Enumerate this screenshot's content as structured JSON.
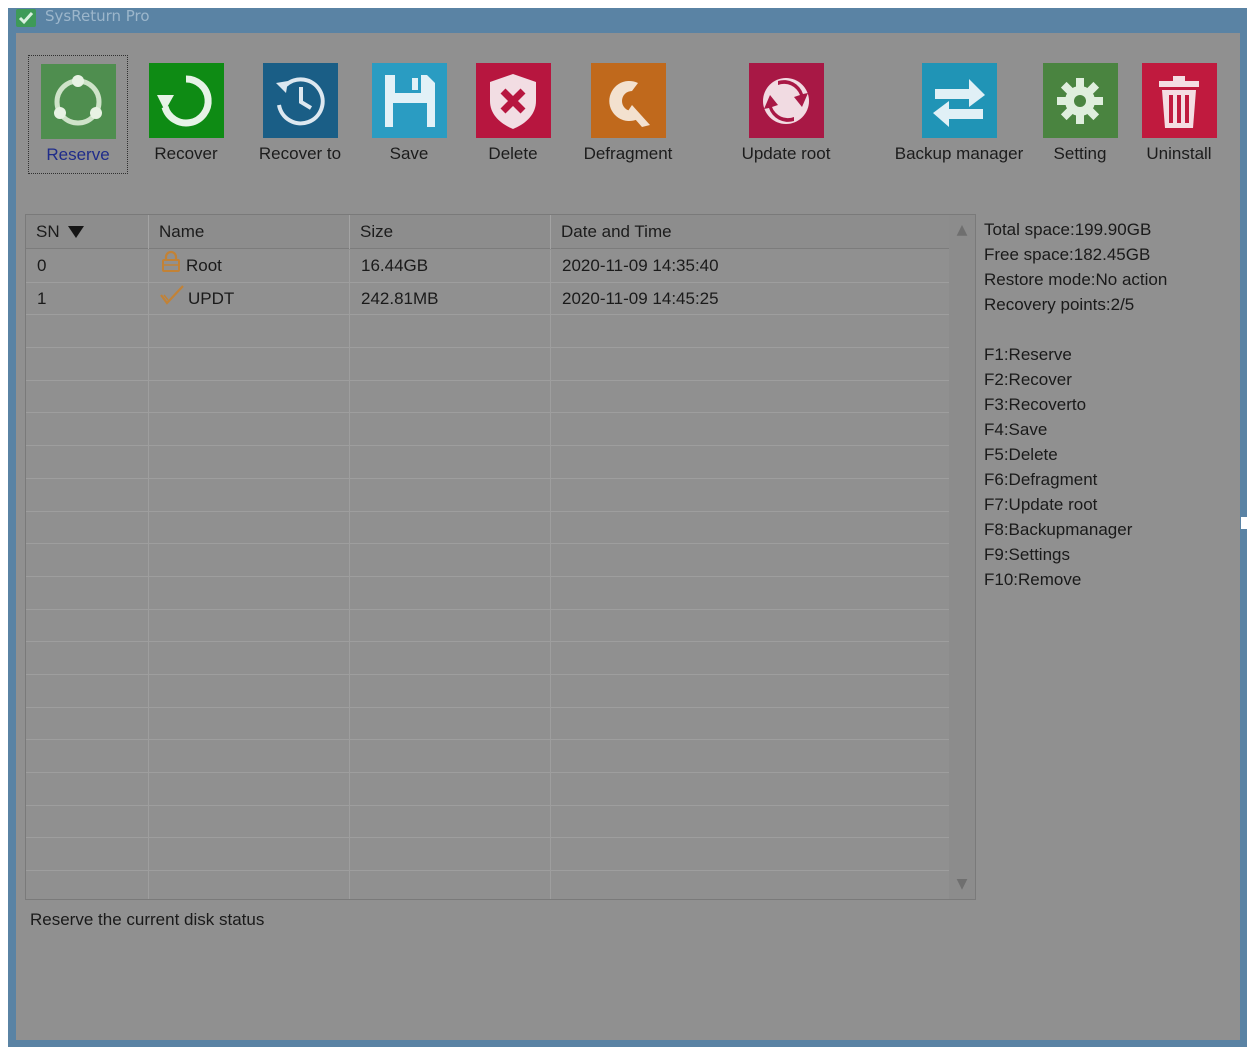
{
  "window": {
    "title": "SysReturn Pro"
  },
  "toolbar": {
    "items": [
      {
        "label": "Reserve",
        "icon": "reserve-icon",
        "color": "#4f8e4f"
      },
      {
        "label": "Recover",
        "icon": "recover-icon",
        "color": "#0e8b14"
      },
      {
        "label": "Recover to",
        "icon": "history-icon",
        "color": "#1a5e86"
      },
      {
        "label": "Save",
        "icon": "save-icon",
        "color": "#2a9cc2"
      },
      {
        "label": "Delete",
        "icon": "delete-shield-icon",
        "color": "#b7163f"
      },
      {
        "label": "Defragment",
        "icon": "defragment-icon",
        "color": "#c0691c"
      },
      {
        "label": "Update root",
        "icon": "update-icon",
        "color": "#a81845"
      },
      {
        "label": "Backup manager",
        "icon": "swap-arrows-icon",
        "color": "#2094b6"
      },
      {
        "label": "Setting",
        "icon": "gear-icon",
        "color": "#4a8440"
      },
      {
        "label": "Uninstall",
        "icon": "trash-icon",
        "color": "#c01a3e"
      }
    ]
  },
  "table": {
    "headers": {
      "sn": "SN",
      "sort_icon": "sort-descending-icon",
      "name": "Name",
      "size": "Size",
      "datetime": "Date and Time"
    },
    "rows": [
      {
        "sn": "0",
        "name": "Root",
        "icon": "lock-icon",
        "size": "16.44GB",
        "datetime": "2020-11-09 14:35:40"
      },
      {
        "sn": "1",
        "name": "UPDT",
        "icon": "checkmark-icon",
        "size": "242.81MB",
        "datetime": "2020-11-09 14:45:25"
      }
    ]
  },
  "info": {
    "total_space": "Total space:199.90GB",
    "free_space": "Free space:182.45GB",
    "restore_mode": "Restore mode:No action",
    "recovery_points": "Recovery points:2/5",
    "shortcuts": [
      "F1:Reserve",
      "F2:Recover",
      "F3:Recoverto",
      "F4:Save",
      "F5:Delete",
      "F6:Defragment",
      "F7:Update root",
      "F8:Backupmanager",
      "F9:Settings",
      "F10:Remove"
    ]
  },
  "status": {
    "text": "Reserve the current disk status"
  }
}
